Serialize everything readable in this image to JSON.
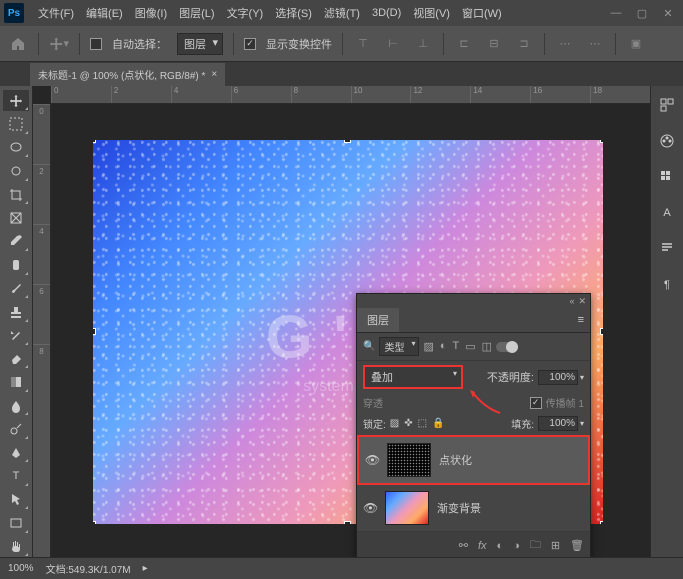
{
  "menu": {
    "items": [
      "文件(F)",
      "编辑(E)",
      "图像(I)",
      "图层(L)",
      "文字(Y)",
      "选择(S)",
      "滤镜(T)",
      "3D(D)",
      "视图(V)",
      "窗口(W)"
    ]
  },
  "options": {
    "auto_select_label": "自动选择：",
    "auto_select_target": "图层",
    "show_transform_label": "显示变换控件"
  },
  "tab": {
    "title": "未标题-1 @ 100% (点状化, RGB/8#) *"
  },
  "ruler": {
    "h": [
      "0",
      "2",
      "4",
      "6",
      "8",
      "10",
      "12",
      "14",
      "16",
      "18"
    ],
    "v": [
      "0",
      "2",
      "4",
      "6",
      "8"
    ]
  },
  "watermark": {
    "main": "G ' 网",
    "sub": "system .com"
  },
  "layers": {
    "panel_title": "图层",
    "filter_label": "类型",
    "blend_mode": "叠加",
    "opacity_label": "不透明度:",
    "opacity_value": "100%",
    "propagate_label": "传播帧 1",
    "pass_label": "穿透",
    "lock_label": "锁定:",
    "fill_label": "填充:",
    "fill_value": "100%",
    "items": [
      {
        "name": "点状化"
      },
      {
        "name": "渐变背景"
      }
    ]
  },
  "status": {
    "zoom": "100%",
    "doc_info": "文档:549.3K/1.07M"
  }
}
